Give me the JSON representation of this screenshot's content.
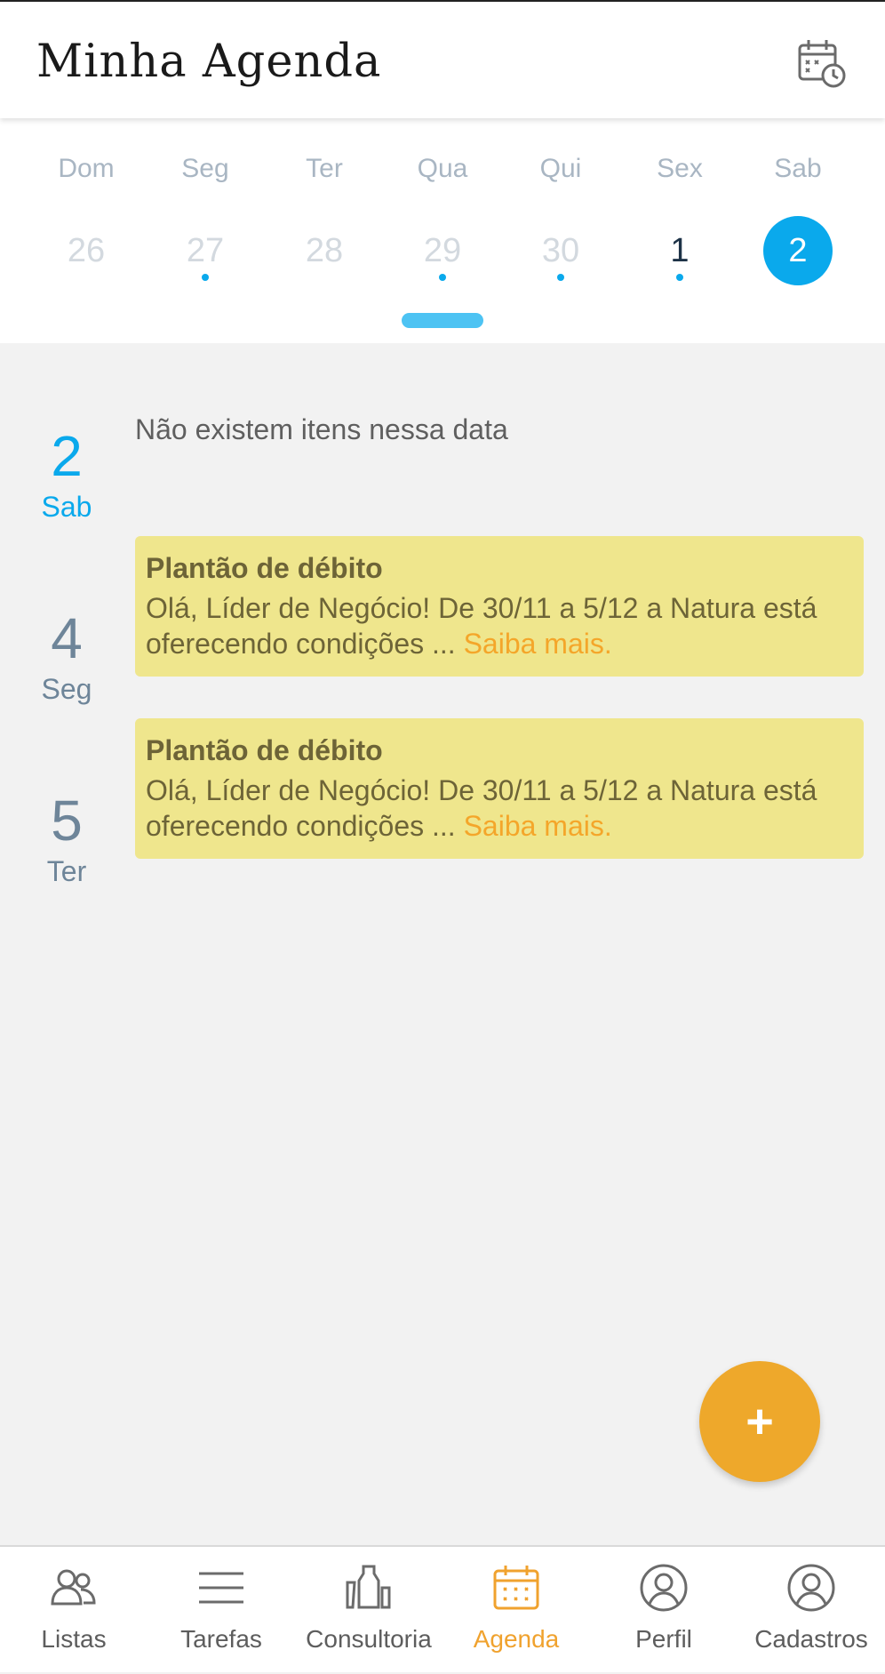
{
  "header": {
    "title": "Minha Agenda",
    "calendar_icon": "calendar-clock-icon"
  },
  "week": {
    "days": [
      {
        "name": "Dom",
        "num": "26",
        "dot": false,
        "state": "faded"
      },
      {
        "name": "Seg",
        "num": "27",
        "dot": true,
        "state": "faded"
      },
      {
        "name": "Ter",
        "num": "28",
        "dot": false,
        "state": "faded"
      },
      {
        "name": "Qua",
        "num": "29",
        "dot": true,
        "state": "faded"
      },
      {
        "name": "Qui",
        "num": "30",
        "dot": true,
        "state": "faded"
      },
      {
        "name": "Sex",
        "num": "1",
        "dot": true,
        "state": "current"
      },
      {
        "name": "Sab",
        "num": "2",
        "dot": false,
        "state": "selected"
      }
    ]
  },
  "agenda": {
    "groups": [
      {
        "num": "2",
        "weekday": "Sab",
        "empty_text": "Não existem itens nessa data"
      },
      {
        "num": "4",
        "weekday": "Seg",
        "title": "Plantão de débito",
        "body": "Olá, Líder de Negócio! De 30/11  a 5/12 a Natura está oferecendo condições ...",
        "more": "Saiba mais."
      },
      {
        "num": "5",
        "weekday": "Ter",
        "title": "Plantão de débito",
        "body": "Olá, Líder de Negócio! De 30/11  a 5/12 a Natura está oferecendo condições ...",
        "more": "Saiba mais."
      }
    ]
  },
  "fab": {
    "label": "+"
  },
  "nav": {
    "items": [
      {
        "label": "Listas",
        "icon": "people-icon"
      },
      {
        "label": "Tarefas",
        "icon": "list-icon"
      },
      {
        "label": "Consultoria",
        "icon": "products-icon"
      },
      {
        "label": "Agenda",
        "icon": "calendar-icon",
        "active": true
      },
      {
        "label": "Perfil",
        "icon": "user-circle-icon"
      },
      {
        "label": "Cadastros",
        "icon": "user-circle-icon"
      }
    ]
  },
  "colors": {
    "accent": "#0aa9ec",
    "orange": "#eea82b",
    "card": "#efe68d"
  }
}
